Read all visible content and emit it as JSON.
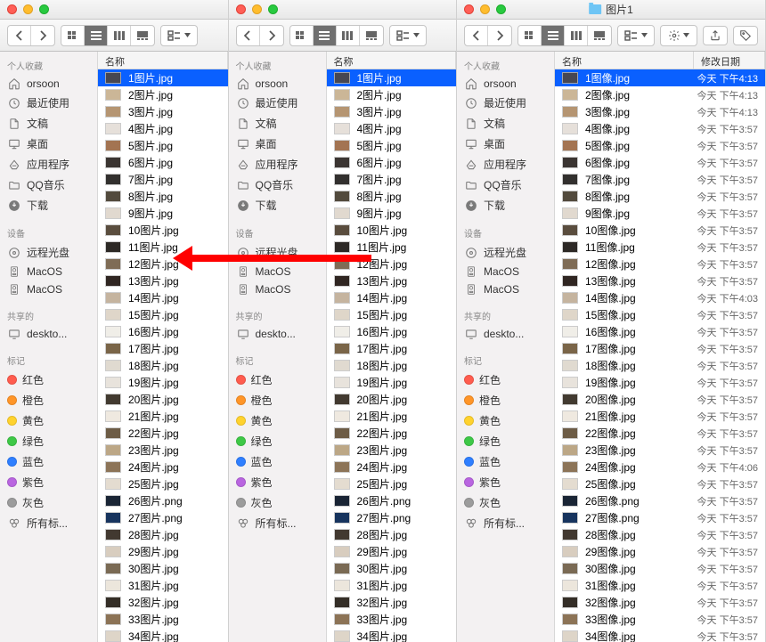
{
  "windows": [
    {
      "title": ""
    },
    {
      "title": ""
    },
    {
      "title": "图片1"
    }
  ],
  "sidebar": {
    "groups": [
      {
        "header": "个人收藏",
        "items": [
          {
            "icon": "home",
            "label": "orsoon"
          },
          {
            "icon": "clock",
            "label": "最近使用"
          },
          {
            "icon": "doc",
            "label": "文稿"
          },
          {
            "icon": "desktop",
            "label": "桌面"
          },
          {
            "icon": "app",
            "label": "应用程序"
          },
          {
            "icon": "folder",
            "label": "QQ音乐"
          },
          {
            "icon": "download",
            "label": "下载"
          }
        ]
      },
      {
        "header": "设备",
        "items": [
          {
            "icon": "disc",
            "label": "远程光盘"
          },
          {
            "icon": "hdd",
            "label": "MacOS"
          },
          {
            "icon": "hdd",
            "label": "MacOS"
          }
        ]
      },
      {
        "header": "共享的",
        "items": [
          {
            "icon": "monitor",
            "label": "deskto..."
          }
        ]
      },
      {
        "header": "标记",
        "items": [
          {
            "tag": "#ff5c4e",
            "label": "红色"
          },
          {
            "tag": "#ff9528",
            "label": "橙色"
          },
          {
            "tag": "#ffd22e",
            "label": "黄色"
          },
          {
            "tag": "#3ec847",
            "label": "绿色"
          },
          {
            "tag": "#2f7fff",
            "label": "蓝色"
          },
          {
            "tag": "#b965e0",
            "label": "紫色"
          },
          {
            "tag": "#9c9c9c",
            "label": "灰色"
          },
          {
            "icon": "alltags",
            "label": "所有标..."
          }
        ]
      }
    ]
  },
  "headers": {
    "name": "名称",
    "date": "修改日期"
  },
  "filesA": [
    {
      "n": "1图片.jpg",
      "sel": true,
      "c": "#474752"
    },
    {
      "n": "2图片.jpg",
      "c": "#cbb697"
    },
    {
      "n": "3图片.jpg",
      "c": "#b59572"
    },
    {
      "n": "4图片.jpg",
      "c": "#e6e0da"
    },
    {
      "n": "5图片.jpg",
      "c": "#a37452"
    },
    {
      "n": "6图片.jpg",
      "c": "#3b3532"
    },
    {
      "n": "7图片.jpg",
      "c": "#32302e"
    },
    {
      "n": "8图片.jpg",
      "c": "#524a3d"
    },
    {
      "n": "9图片.jpg",
      "c": "#e1d9cf"
    },
    {
      "n": "10图片.jpg",
      "c": "#5a4d3e"
    },
    {
      "n": "11图片.jpg",
      "c": "#2d2926"
    },
    {
      "n": "12图片.jpg",
      "c": "#7f6c56"
    },
    {
      "n": "13图片.jpg",
      "c": "#302622"
    },
    {
      "n": "14图片.jpg",
      "c": "#c5b49f"
    },
    {
      "n": "15图片.jpg",
      "c": "#dfd6c9"
    },
    {
      "n": "16图片.jpg",
      "c": "#f0eee8"
    },
    {
      "n": "17图片.jpg",
      "c": "#7a6548"
    },
    {
      "n": "18图片.jpg",
      "c": "#e0dad0"
    },
    {
      "n": "19图片.jpg",
      "c": "#e8e3dc"
    },
    {
      "n": "20图片.jpg",
      "c": "#423a30"
    },
    {
      "n": "21图片.jpg",
      "c": "#efe9e0"
    },
    {
      "n": "22图片.jpg",
      "c": "#6d5c46"
    },
    {
      "n": "23图片.jpg",
      "c": "#bca786"
    },
    {
      "n": "24图片.jpg",
      "c": "#8c7458"
    },
    {
      "n": "25图片.jpg",
      "c": "#e4dcd0"
    },
    {
      "n": "26图片.png",
      "c": "#1a2535"
    },
    {
      "n": "27图片.png",
      "c": "#17345e"
    },
    {
      "n": "28图片.jpg",
      "c": "#423930"
    },
    {
      "n": "29图片.jpg",
      "c": "#d8cdbf"
    },
    {
      "n": "30图片.jpg",
      "c": "#7a6a54"
    },
    {
      "n": "31图片.jpg",
      "c": "#ece6dc"
    },
    {
      "n": "32图片.jpg",
      "c": "#342e27"
    },
    {
      "n": "33图片.jpg",
      "c": "#8c7356"
    },
    {
      "n": "34图片.jpg",
      "c": "#ded5c8"
    }
  ],
  "filesB": [
    {
      "n": "1图像.jpg",
      "d": "今天 下午4:13",
      "sel": true,
      "c": "#474752"
    },
    {
      "n": "2图像.jpg",
      "d": "今天 下午4:13",
      "c": "#cbb697"
    },
    {
      "n": "3图像.jpg",
      "d": "今天 下午4:13",
      "c": "#b59572"
    },
    {
      "n": "4图像.jpg",
      "d": "今天 下午3:57",
      "c": "#e6e0da"
    },
    {
      "n": "5图像.jpg",
      "d": "今天 下午3:57",
      "c": "#a37452"
    },
    {
      "n": "6图像.jpg",
      "d": "今天 下午3:57",
      "c": "#3b3532"
    },
    {
      "n": "7图像.jpg",
      "d": "今天 下午3:57",
      "c": "#32302e"
    },
    {
      "n": "8图像.jpg",
      "d": "今天 下午3:57",
      "c": "#524a3d"
    },
    {
      "n": "9图像.jpg",
      "d": "今天 下午3:57",
      "c": "#e1d9cf"
    },
    {
      "n": "10图像.jpg",
      "d": "今天 下午3:57",
      "c": "#5a4d3e"
    },
    {
      "n": "11图像.jpg",
      "d": "今天 下午3:57",
      "c": "#2d2926"
    },
    {
      "n": "12图像.jpg",
      "d": "今天 下午3:57",
      "c": "#7f6c56"
    },
    {
      "n": "13图像.jpg",
      "d": "今天 下午3:57",
      "c": "#302622"
    },
    {
      "n": "14图像.jpg",
      "d": "今天 下午4:03",
      "c": "#c5b49f"
    },
    {
      "n": "15图像.jpg",
      "d": "今天 下午3:57",
      "c": "#dfd6c9"
    },
    {
      "n": "16图像.jpg",
      "d": "今天 下午3:57",
      "c": "#f0eee8"
    },
    {
      "n": "17图像.jpg",
      "d": "今天 下午3:57",
      "c": "#7a6548"
    },
    {
      "n": "18图像.jpg",
      "d": "今天 下午3:57",
      "c": "#e0dad0"
    },
    {
      "n": "19图像.jpg",
      "d": "今天 下午3:57",
      "c": "#e8e3dc"
    },
    {
      "n": "20图像.jpg",
      "d": "今天 下午3:57",
      "c": "#423a30"
    },
    {
      "n": "21图像.jpg",
      "d": "今天 下午3:57",
      "c": "#efe9e0"
    },
    {
      "n": "22图像.jpg",
      "d": "今天 下午3:57",
      "c": "#6d5c46"
    },
    {
      "n": "23图像.jpg",
      "d": "今天 下午3:57",
      "c": "#bca786"
    },
    {
      "n": "24图像.jpg",
      "d": "今天 下午4:06",
      "c": "#8c7458"
    },
    {
      "n": "25图像.jpg",
      "d": "今天 下午3:57",
      "c": "#e4dcd0"
    },
    {
      "n": "26图像.png",
      "d": "今天 下午3:57",
      "c": "#1a2535"
    },
    {
      "n": "27图像.png",
      "d": "今天 下午3:57",
      "c": "#17345e"
    },
    {
      "n": "28图像.jpg",
      "d": "今天 下午3:57",
      "c": "#423930"
    },
    {
      "n": "29图像.jpg",
      "d": "今天 下午3:57",
      "c": "#d8cdbf"
    },
    {
      "n": "30图像.jpg",
      "d": "今天 下午3:57",
      "c": "#7a6a54"
    },
    {
      "n": "31图像.jpg",
      "d": "今天 下午3:57",
      "c": "#ece6dc"
    },
    {
      "n": "32图像.jpg",
      "d": "今天 下午3:57",
      "c": "#342e27"
    },
    {
      "n": "33图像.jpg",
      "d": "今天 下午3:57",
      "c": "#8c7356"
    },
    {
      "n": "34图像.jpg",
      "d": "今天 下午3:57",
      "c": "#ded5c8"
    }
  ]
}
